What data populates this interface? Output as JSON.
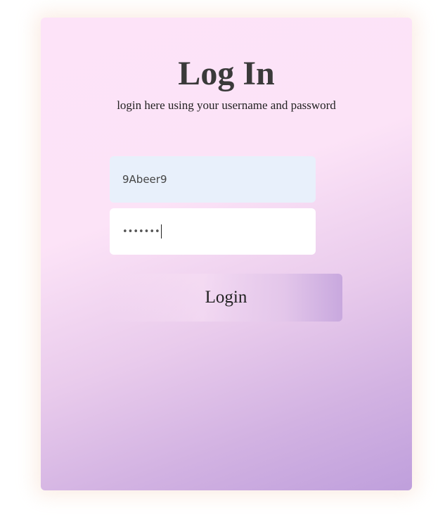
{
  "login_card": {
    "title": "Log In",
    "subtitle": "login here using your username and password"
  },
  "username_field": {
    "value": "9Abeer9"
  },
  "password_field": {
    "masked_value": "•••••••"
  },
  "login_button": {
    "label": "Login"
  },
  "colors": {
    "card_gradient_start": "#fde3f8",
    "card_gradient_end": "#bf9fdc",
    "username_bg": "#e8f0fb",
    "password_bg": "#ffffff",
    "title_text": "#3a3a3a"
  }
}
